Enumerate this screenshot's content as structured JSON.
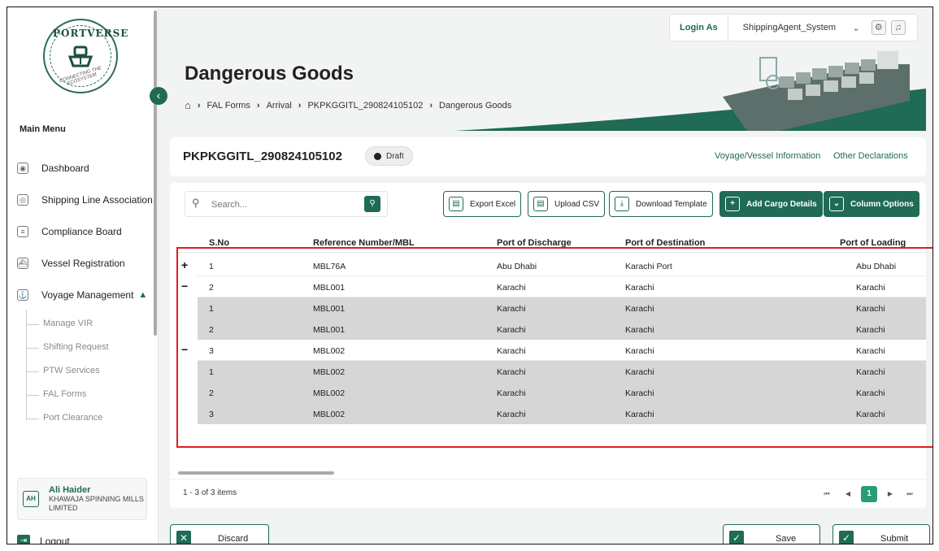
{
  "sidebar": {
    "logo": {
      "brand": "PORTVERSE",
      "tagline": "CONNECTING THE ECOSYSTEM"
    },
    "menu_title": "Main Menu",
    "items": [
      {
        "label": "Dashboard",
        "icon": "dashboard-icon"
      },
      {
        "label": "Shipping Line Association",
        "icon": "association-icon"
      },
      {
        "label": "Compliance Board",
        "icon": "document-icon"
      },
      {
        "label": "Vessel Registration",
        "icon": "ship-icon"
      },
      {
        "label": "Voyage Management",
        "icon": "anchor-icon",
        "expanded": true
      }
    ],
    "sub_items": [
      "Manage VIR",
      "Shifting Request",
      "PTW Services",
      "FAL Forms",
      "Port Clearance"
    ],
    "user": {
      "initials": "AH",
      "name": "Ali Haider",
      "company": "KHAWAJA SPINNING MILLS LIMITED"
    },
    "logout_label": "Logout"
  },
  "topbar": {
    "login_as_label": "Login As",
    "role": "ShippingAgent_System"
  },
  "header": {
    "title": "Dangerous Goods",
    "breadcrumb": [
      "FAL Forms",
      "Arrival",
      "PKPKGGITL_290824105102",
      "Dangerous Goods"
    ]
  },
  "reference": {
    "number": "PKPKGGITL_290824105102",
    "status": "Draft",
    "links": [
      "Voyage/Vessel Information",
      "Other Declarations"
    ]
  },
  "toolbar": {
    "search_placeholder": "Search...",
    "buttons": [
      "Export Excel",
      "Upload CSV",
      "Download Template",
      "Add Cargo Details",
      "Column Options"
    ]
  },
  "table": {
    "columns": [
      "S.No",
      "Reference Number/MBL",
      "Port of Discharge",
      "Port of Destination",
      "Port of Loading"
    ],
    "rows": [
      {
        "type": "parent",
        "toggle": "+",
        "sno": "1",
        "ref": "MBL76A",
        "pod": "Abu Dhabi",
        "dest": "Karachi Port",
        "pol": "Abu Dhabi"
      },
      {
        "type": "parent",
        "toggle": "−",
        "sno": "2",
        "ref": "MBL001",
        "pod": "Karachi",
        "dest": "Karachi",
        "pol": "Karachi"
      },
      {
        "type": "child",
        "toggle": "",
        "sno": "1",
        "ref": "MBL001",
        "pod": "Karachi",
        "dest": "Karachi",
        "pol": "Karachi"
      },
      {
        "type": "child",
        "toggle": "",
        "sno": "2",
        "ref": "MBL001",
        "pod": "Karachi",
        "dest": "Karachi",
        "pol": "Karachi"
      },
      {
        "type": "parent",
        "toggle": "−",
        "sno": "3",
        "ref": "MBL002",
        "pod": "Karachi",
        "dest": "Karachi",
        "pol": "Karachi"
      },
      {
        "type": "child",
        "toggle": "",
        "sno": "1",
        "ref": "MBL002",
        "pod": "Karachi",
        "dest": "Karachi",
        "pol": "Karachi"
      },
      {
        "type": "child",
        "toggle": "",
        "sno": "2",
        "ref": "MBL002",
        "pod": "Karachi",
        "dest": "Karachi",
        "pol": "Karachi"
      },
      {
        "type": "child",
        "toggle": "",
        "sno": "3",
        "ref": "MBL002",
        "pod": "Karachi",
        "dest": "Karachi",
        "pol": "Karachi"
      }
    ]
  },
  "pagination": {
    "summary": "1 - 3 of 3 items",
    "current_page": "1"
  },
  "footer": {
    "discard_label": "Discard",
    "save_label": "Save",
    "submit_label": "Submit"
  },
  "colors": {
    "brand": "#1f6b55",
    "accent": "#2a9d78",
    "highlight": "#e31b23",
    "child_row": "#d6d6d6"
  }
}
